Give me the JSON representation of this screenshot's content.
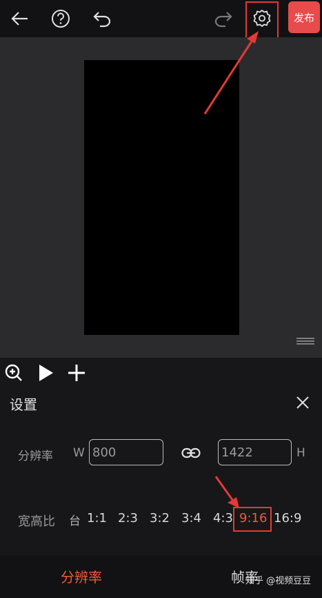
{
  "topbar": {
    "publish_label": "发布"
  },
  "settings": {
    "title": "设置",
    "resolution_label": "分辨率",
    "width_prefix": "W",
    "width_value": "800",
    "height_value": "1422",
    "height_suffix": "H",
    "aspect_label": "宽高比",
    "aspect_options": [
      "台",
      "1:1",
      "2:3",
      "3:2",
      "3:4",
      "4:3",
      "9:16",
      "16:9"
    ],
    "selected_aspect": "9:16"
  },
  "bottom_tabs": [
    "分辨率",
    "帧率"
  ],
  "watermark": "知乎 @视频豆豆",
  "colors": {
    "accent": "#f05a3a",
    "highlight": "#e53935",
    "publish_bg": "#e74b4b"
  }
}
